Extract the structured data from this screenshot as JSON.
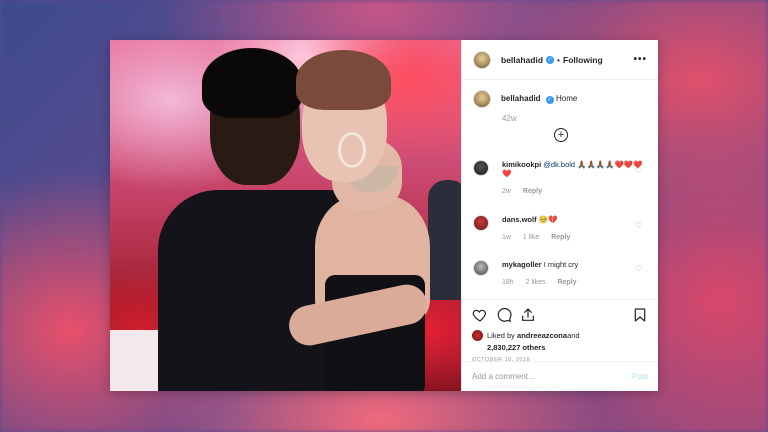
{
  "post": {
    "username": "bellahadid",
    "verified_icon": "✓",
    "separator": "•",
    "follow_status": "Following",
    "more_label": "•••",
    "caption": {
      "username": "bellahadid",
      "text": "Home",
      "time": "42w"
    },
    "load_more_icon": "+",
    "comments": [
      {
        "username": "kimikookpi",
        "mention": "@dk.bold",
        "text": " 🙏🏾🙏🏾🙏🏾🙏🏾❤️❤️❤️❤️",
        "time": "2w",
        "likes": "",
        "reply": "Reply"
      },
      {
        "username": "dans.wolf",
        "mention": "",
        "text": " 🥺💔",
        "time": "1w",
        "likes": "1 like",
        "reply": "Reply"
      },
      {
        "username": "mykagoller",
        "mention": "",
        "text": " I might cry",
        "time": "18h",
        "likes": "2 likes",
        "reply": "Reply"
      }
    ],
    "liked_by": {
      "prefix": "Liked by ",
      "user": "andreeazcona",
      "joiner": " and",
      "count": "2,830,227 others"
    },
    "date": "OCTOBER 18, 2018",
    "add_comment_placeholder": "Add a comment...",
    "post_label": "Post"
  },
  "colors": {
    "verified": "#3897f0",
    "link_blue": "#003569",
    "post_disabled": "#b2dffc"
  }
}
